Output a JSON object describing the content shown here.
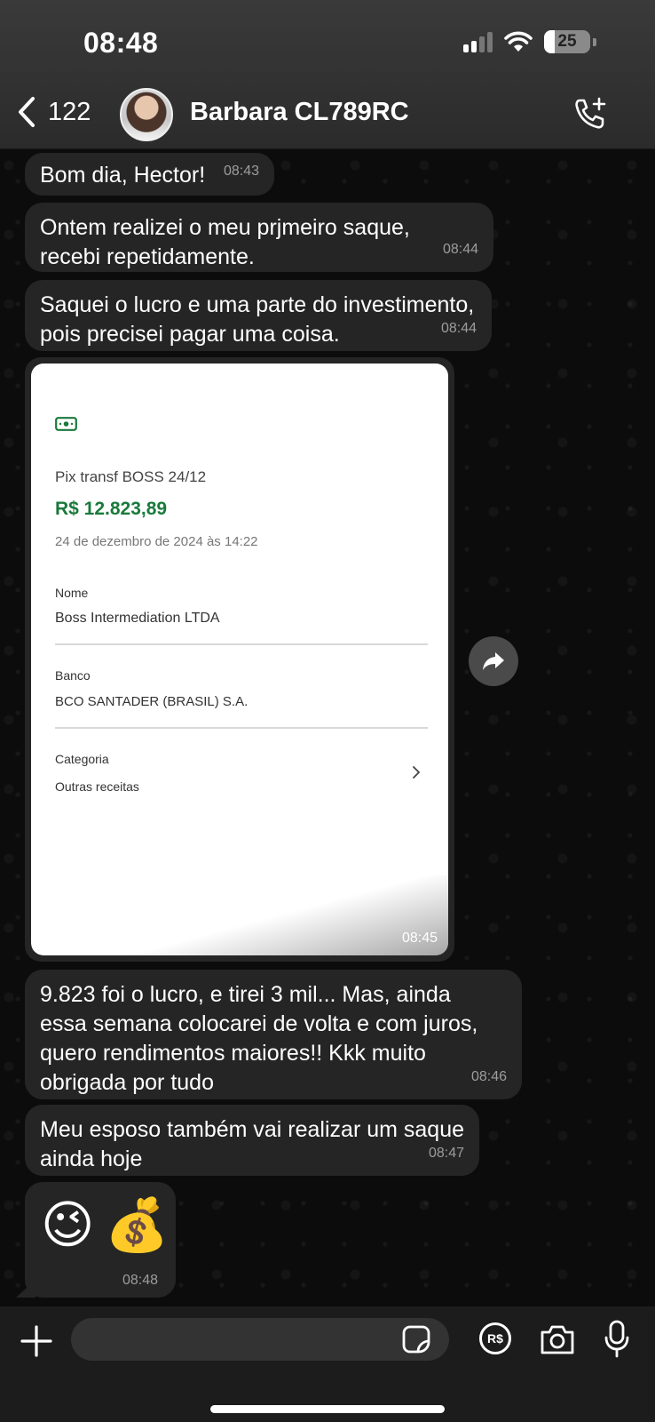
{
  "status_bar": {
    "time": "08:48",
    "battery": "25",
    "icons": [
      "signal-icon",
      "wifi-icon",
      "battery-icon"
    ]
  },
  "header": {
    "back_count": "122",
    "contact_name": "Barbara CL789RC",
    "icons": [
      "chevron-left-icon",
      "call-add-icon"
    ]
  },
  "messages": [
    {
      "text": "Bom dia, Hector!",
      "time": "08:43"
    },
    {
      "text": "Ontem realizei o meu prjmeiro saque, recebi repetidamente.",
      "time": "08:44"
    },
    {
      "text": "Saquei o lucro e uma parte do investimento, pois precisei pagar uma coisa.",
      "time": "08:44"
    },
    {
      "type": "image",
      "time": "08:45",
      "receipt": {
        "title": "Pix transf BOSS 24/12",
        "amount": "R$ 12.823,89",
        "date": "24 de dezembro de 2024 às 14:22",
        "name_label": "Nome",
        "name_value": "Boss Intermediation LTDA",
        "bank_label": "Banco",
        "bank_value": "BCO SANTADER (BRASIL) S.A.",
        "category_label": "Categoria",
        "category_value": "Outras receitas"
      }
    },
    {
      "text": "9.823 foi o lucro, e tirei 3 mil... Mas, ainda essa semana colocarei de volta e com juros, quero rendimentos maiores!! Kkk muito obrigada por tudo",
      "time": "08:46"
    },
    {
      "text": "Meu esposo também vai realizar um saque ainda hoje",
      "time": "08:47"
    },
    {
      "emojis": [
        "😉",
        "💰"
      ],
      "time": "08:48"
    }
  ],
  "composer": {
    "placeholder": "",
    "pay_label": "R$",
    "icons": [
      "plus-icon",
      "sticker-icon",
      "payment-icon",
      "camera-icon",
      "microphone-icon"
    ]
  },
  "colors": {
    "bubble": "#252525",
    "header": "#2f2f2f",
    "amount_green": "#1a7a3b",
    "background": "#0c0c0c"
  }
}
